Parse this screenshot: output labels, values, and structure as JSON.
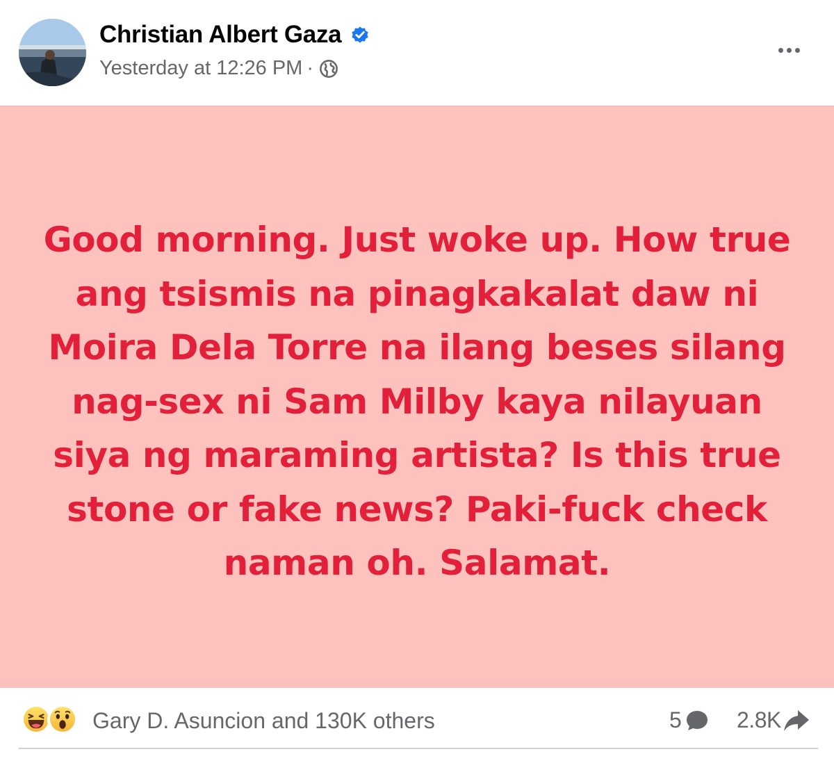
{
  "post": {
    "author": "Christian Albert Gaza",
    "timestamp": "Yesterday at 12:26 PM",
    "separator": "·",
    "audience_icon": "globe-icon",
    "verified_icon": "verified-badge-icon",
    "more_icon": "more-options-icon",
    "background_color": "#fdc2be",
    "text_color": "#e2203a",
    "text": "Good morning. Just woke up. How true ang tsismis na pinagkakalat daw ni Moira Dela Torre na ilang beses silang nag-sex ni Sam Milby kaya nilayuan siya ng maraming artista? Is this true stone or fake news? Paki-fuck check naman oh. Salamat."
  },
  "footer": {
    "reactions": [
      "haha-reaction-icon",
      "wow-reaction-icon"
    ],
    "reaction_summary": "Gary D. Asuncion and 130K others",
    "comment_count": "5",
    "share_count": "2.8K"
  }
}
